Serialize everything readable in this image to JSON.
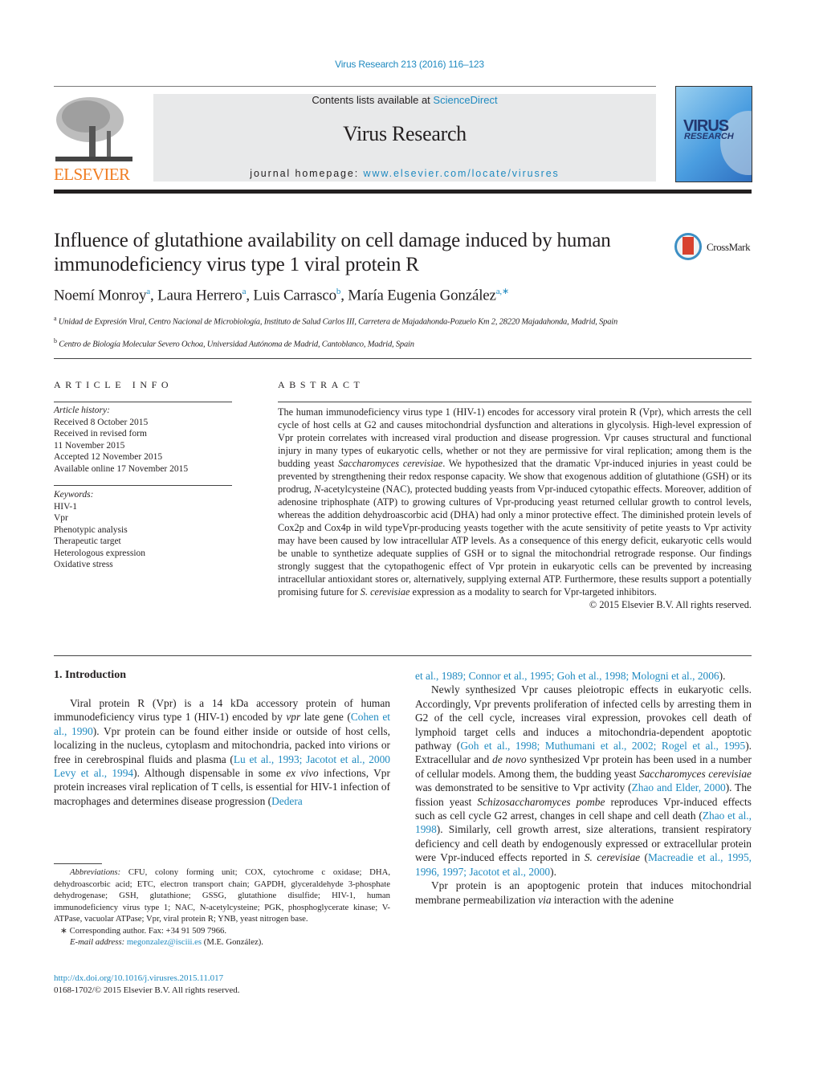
{
  "header": {
    "citation": "Virus Research 213 (2016) 116–123",
    "contents_prefix": "Contents lists available at ",
    "contents_link": "ScienceDirect",
    "journal_title": "Virus Research",
    "homepage_prefix": "journal homepage: ",
    "homepage_url": "www.elsevier.com/locate/virusres",
    "publisher_logo_text": "ELSEVIER",
    "cover_title_1": "VIRUS",
    "cover_title_2": "RESEARCH"
  },
  "article": {
    "title": "Influence of glutathione availability on cell damage induced by human immunodeficiency virus type 1 viral protein R",
    "crossmark_label": "CrossMark",
    "authors": [
      {
        "name": "Noemí Monroy",
        "sup": "a"
      },
      {
        "name": "Laura Herrero",
        "sup": "a"
      },
      {
        "name": "Luis Carrasco",
        "sup": "b"
      },
      {
        "name": "María Eugenia González",
        "sup": "a,∗"
      }
    ],
    "affiliations": [
      {
        "mark": "a",
        "text": "Unidad de Expresión Viral, Centro Nacional de Microbiología, Instituto de Salud Carlos III, Carretera de Majadahonda-Pozuelo Km 2, 28220 Majadahonda, Madrid, Spain"
      },
      {
        "mark": "b",
        "text": "Centro de Biología Molecular Severo Ochoa, Universidad Autónoma de Madrid, Cantoblanco, Madrid, Spain"
      }
    ]
  },
  "article_info": {
    "heading": "ARTICLE INFO",
    "history_label": "Article history:",
    "history": [
      "Received 8 October 2015",
      "Received in revised form",
      "11 November 2015",
      "Accepted 12 November 2015",
      "Available online 17 November 2015"
    ],
    "keywords_label": "Keywords:",
    "keywords": [
      "HIV-1",
      "Vpr",
      "Phenotypic analysis",
      "Therapeutic target",
      "Heterologous expression",
      "Oxidative stress"
    ]
  },
  "abstract": {
    "heading": "ABSTRACT",
    "part1": "The human immunodeficiency virus type 1 (HIV-1) encodes for accessory viral protein R (Vpr), which arrests the cell cycle of host cells at G2 and causes mitochondrial dysfunction and alterations in glycolysis. High-level expression of Vpr protein correlates with increased viral production and disease progression. Vpr causes structural and functional injury in many types of eukaryotic cells, whether or not they are permissive for viral replication; among them is the budding yeast ",
    "italic1": "Saccharomyces cerevisiae",
    "part2": ". We hypothesized that the dramatic Vpr-induced injuries in yeast could be prevented by strengthening their redox response capacity. We show that exogenous addition of glutathione (GSH) or its prodrug, ",
    "italic2": "N",
    "part3": "-acetylcysteine (NAC), protected budding yeasts from Vpr-induced cytopathic effects. Moreover, addition of adenosine triphosphate (ATP) to growing cultures of Vpr-producing yeast returned cellular growth to control levels, whereas the addition dehydroascorbic acid (DHA) had only a minor protective effect. The diminished protein levels of Cox2p and Cox4p in wild typeVpr-producing yeasts together with the acute sensitivity of petite yeasts to Vpr activity may have been caused by low intracellular ATP levels. As a consequence of this energy deficit, eukaryotic cells would be unable to synthetize adequate supplies of GSH or to signal the mitochondrial retrograde response. Our findings strongly suggest that the cytopathogenic effect of Vpr protein in eukaryotic cells can be prevented by increasing intracellular antioxidant stores or, alternatively, supplying external ATP. Furthermore, these results support a potentially promising future for ",
    "italic3": "S. cerevisiae",
    "part4": " expression as a modality to search for Vpr-targeted inhibitors.",
    "copyright": "© 2015 Elsevier B.V. All rights reserved."
  },
  "introduction": {
    "heading": "1.  Introduction",
    "left_p1": [
      {
        "t": "Viral protein R (Vpr) is a 14 kDa accessory protein of human immunodeficiency virus type 1 (HIV-1) encoded by "
      },
      {
        "i": "vpr"
      },
      {
        "t": " late gene ("
      },
      {
        "l": "Cohen et al., 1990"
      },
      {
        "t": "). Vpr protein can be found either inside or outside of host cells, localizing in the nucleus, cytoplasm and mitochondria, packed into virions or free in cerebrospinal fluids and plasma ("
      },
      {
        "l": "Lu et al., 1993; Jacotot et al., 2000 Levy et al., 1994"
      },
      {
        "t": "). Although dispensable in some "
      },
      {
        "i": "ex vivo"
      },
      {
        "t": " infections, Vpr protein increases viral replication of T cells, is essential for HIV-1 infection of macrophages and determines disease progression ("
      },
      {
        "l": "Dedera"
      }
    ],
    "right_cont": [
      {
        "l": "et al., 1989; Connor et al., 1995; Goh et al., 1998; Mologni et al., 2006"
      },
      {
        "t": ")."
      }
    ],
    "right_p2": [
      {
        "t": "Newly synthesized Vpr causes pleiotropic effects in eukaryotic cells. Accordingly, Vpr prevents proliferation of infected cells by arresting them in G2 of the cell cycle, increases viral expression, provokes cell death of lymphoid target cells and induces a mitochondria-dependent apoptotic pathway ("
      },
      {
        "l": "Goh et al., 1998; Muthumani et al., 2002; Rogel et al., 1995"
      },
      {
        "t": "). Extracellular and "
      },
      {
        "i": "de novo"
      },
      {
        "t": " synthesized Vpr protein has been used in a number of cellular models. Among them, the budding yeast "
      },
      {
        "i": "Saccharomyces cerevisiae"
      },
      {
        "t": " was demonstrated to be sensitive to Vpr activity ("
      },
      {
        "l": "Zhao and Elder, 2000"
      },
      {
        "t": "). The fission yeast "
      },
      {
        "i": "Schizosaccharomyces pombe"
      },
      {
        "t": " reproduces Vpr-induced effects such as cell cycle G2 arrest, changes in cell shape and cell death ("
      },
      {
        "l": "Zhao et al., 1998"
      },
      {
        "t": "). Similarly, cell growth arrest, size alterations, transient respiratory deficiency and cell death by endogenously expressed or extracellular protein were Vpr-induced effects reported in "
      },
      {
        "i": "S. cerevisiae"
      },
      {
        "t": " ("
      },
      {
        "l": "Macreadie et al., 1995, 1996, 1997; Jacotot et al., 2000"
      },
      {
        "t": ")."
      }
    ],
    "right_p3": [
      {
        "t": "Vpr protein is an apoptogenic protein that induces mitochondrial membrane permeabilization "
      },
      {
        "i": "via"
      },
      {
        "t": " interaction with the adenine"
      }
    ]
  },
  "footnotes": {
    "abbrev_label": "Abbreviations:",
    "abbrev_text": " CFU, colony forming unit; COX, cytochrome c oxidase; DHA, dehydroascorbic acid; ETC, electron transport chain; GAPDH, glyceraldehyde 3-phosphate dehydrogenase; GSH, glutathione; GSSG, glutathione disulfide; HIV-1, human immunodeficiency virus type 1; NAC, N-acetylcysteine; PGK, phosphoglycerate kinase; V-ATPase, vacuolar ATPase; Vpr, viral protein R; YNB, yeast nitrogen base.",
    "corresponding": "∗  Corresponding author. Fax: +34 91 509 7966.",
    "email_label": "E-mail address: ",
    "email": "megonzalez@isciii.es",
    "email_suffix": " (M.E. González).",
    "doi": "http://dx.doi.org/10.1016/j.virusres.2015.11.017",
    "issn": "0168-1702/© 2015 Elsevier B.V. All rights reserved."
  },
  "colors": {
    "link": "#1f8ac0",
    "elsevier_orange": "#f07d22",
    "band": "#e8e9ea"
  }
}
